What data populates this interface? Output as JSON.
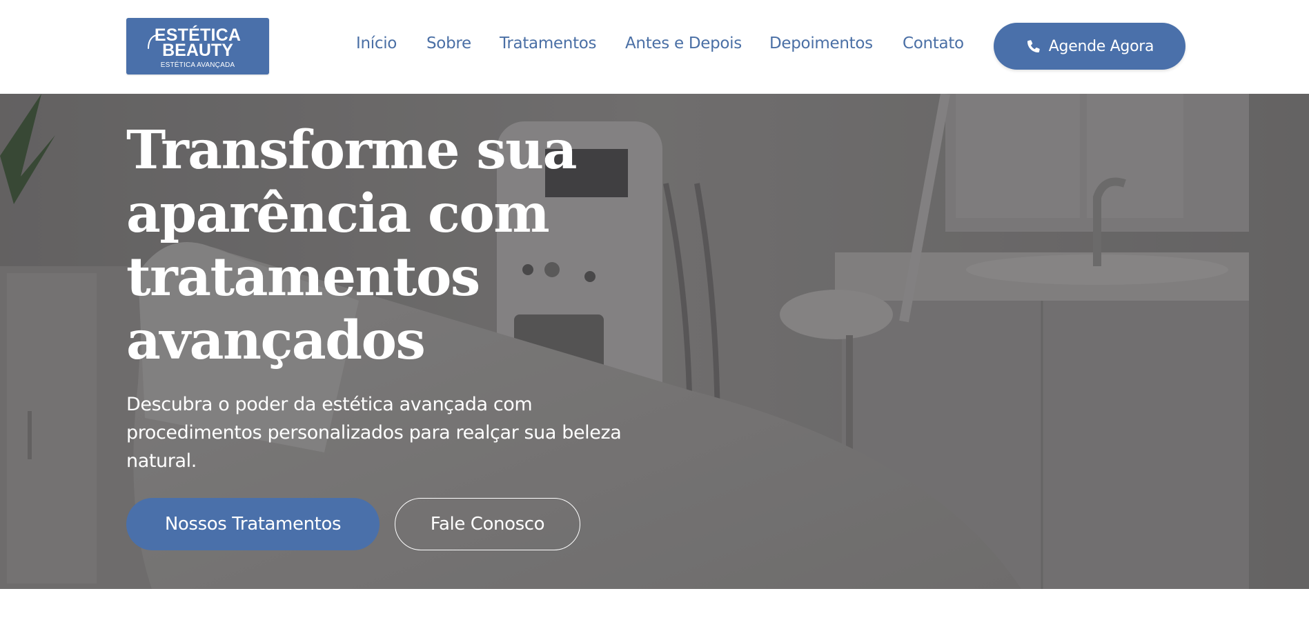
{
  "brand": {
    "name_line1": "ESTÉTICA",
    "name_line2": "BEAUTY",
    "tagline": "ESTÉTICA AVANÇADA",
    "color": "#4a70aa"
  },
  "nav": {
    "items": [
      {
        "label": "Início"
      },
      {
        "label": "Sobre"
      },
      {
        "label": "Tratamentos"
      },
      {
        "label": "Antes e Depois"
      },
      {
        "label": "Depoimentos"
      },
      {
        "label": "Contato"
      }
    ],
    "link_color": "#4a6fa5"
  },
  "header_cta": {
    "label": "Agende Agora",
    "icon": "phone-icon"
  },
  "hero": {
    "title": "Transforme sua aparência com tratamentos avançados",
    "description": "Descubra o poder da estética avançada com procedimentos personalizados para realçar sua beleza natural.",
    "primary_button": "Nossos Tratamentos",
    "secondary_button": "Fale Conosco",
    "background_image": "treatment-room-photo"
  }
}
